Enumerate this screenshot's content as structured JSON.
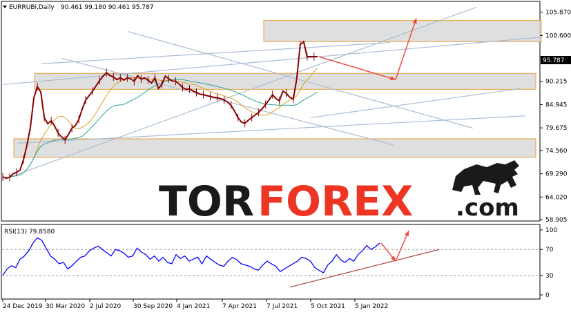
{
  "header": {
    "symbol": "EURRUBi,Daily",
    "ohlc": "90.461 99.180 90.461 95.787"
  },
  "rsi_header": {
    "label": "RSI(13) 79.8580"
  },
  "watermark": {
    "part1": "TOR",
    "part2": "FOREX",
    "part3": ".com",
    "colors": {
      "dark": "#1a1a1a",
      "red": "#ee3524"
    }
  },
  "colors": {
    "candles": "#8b0000",
    "ma_fast": "#d9a020",
    "ma_slow": "#2aa198",
    "rsi_line": "#0000ff",
    "trendline": "#a9bdd6",
    "zone_border": "#e6a23c",
    "arrow": "#f0453a",
    "rsi_trend": "#b04040",
    "current_price_tag": "#000000"
  },
  "chart_data": [
    {
      "type": "line",
      "name": "price",
      "ylim": [
        58.905,
        108.0
      ],
      "y_ticks": [
        "105.870",
        "100.600",
        "95.787",
        "90.215",
        "84.945",
        "79.675",
        "74.560",
        "69.290",
        "64.020",
        "58.905"
      ],
      "x_ticks": [
        "24 Dec 2019",
        "30 Mar 2020",
        "2 Jul 2020",
        "30 Sep 2020",
        "4 Jan 2021",
        "7 Apr 2021",
        "7 Jul 2021",
        "5 Oct 2021",
        "5 Jan 2022"
      ],
      "current_price": "95.787",
      "x_index": [
        0,
        5,
        10,
        15,
        20,
        25,
        30,
        35,
        40,
        45,
        50,
        55,
        60,
        65,
        70,
        75,
        80,
        85,
        90,
        95,
        100,
        105,
        110,
        115,
        120,
        125,
        130,
        135,
        140,
        145,
        150,
        155,
        160,
        165,
        170,
        175,
        180,
        185,
        190,
        195,
        200,
        205,
        210,
        215,
        220,
        225,
        230,
        235,
        240,
        245,
        250,
        255,
        260,
        265,
        270,
        275,
        280,
        285,
        290,
        295,
        300,
        305,
        310,
        315,
        320,
        325,
        330,
        335,
        340,
        345,
        350,
        355,
        360,
        365,
        370,
        375,
        380,
        385,
        390,
        395,
        400,
        405,
        410,
        415,
        420,
        425,
        430,
        435,
        440,
        445,
        450,
        455,
        460,
        465,
        470,
        475,
        480,
        485,
        490,
        495,
        500,
        505,
        510,
        515,
        520,
        525,
        530,
        535,
        540,
        545,
        550,
        555
      ],
      "values": [
        68.6,
        68.3,
        68.5,
        69.3,
        69.6,
        70.1,
        72.5,
        75.8,
        79.9,
        86.5,
        89.0,
        87.8,
        82.0,
        80.6,
        81.3,
        80.1,
        78.5,
        77.6,
        77.0,
        78.2,
        79.6,
        80.2,
        81.6,
        84.0,
        86.0,
        87.0,
        88.0,
        89.2,
        90.4,
        91.4,
        92.2,
        91.5,
        91.2,
        90.6,
        91.0,
        90.5,
        91.0,
        90.8,
        90.2,
        91.5,
        90.7,
        91.0,
        90.5,
        89.8,
        91.0,
        88.6,
        89.5,
        91.4,
        90.8,
        90.3,
        90.2,
        89.6,
        88.8,
        88.4,
        88.5,
        88.0,
        87.7,
        87.3,
        87.2,
        87.0,
        86.8,
        86.6,
        86.5,
        86.3,
        86.0,
        85.5,
        84.8,
        83.5,
        82.0,
        81.0,
        80.7,
        81.4,
        82.0,
        82.6,
        83.2,
        84.0,
        85.0,
        86.0,
        87.2,
        86.3,
        85.8,
        88.0,
        87.5,
        86.6,
        86.2,
        90.8,
        98.5,
        99.2,
        95.8,
        95.8,
        95.8,
        95.8,
        95.8,
        95.8,
        95.8,
        95.8,
        95.8,
        95.8,
        95.8,
        95.8,
        95.8,
        95.8,
        95.8,
        95.8,
        95.8,
        95.8,
        95.8,
        95.8,
        95.8,
        95.8,
        95.8,
        95.8
      ]
    },
    {
      "type": "line",
      "name": "RSI(13)",
      "ylim": [
        0,
        100
      ],
      "y_ticks": [
        "100",
        "70",
        "30",
        "0"
      ],
      "last_value": 79.858,
      "values": [
        30,
        40,
        45,
        42,
        55,
        60,
        68,
        80,
        88,
        84,
        72,
        60,
        55,
        48,
        50,
        40,
        45,
        52,
        58,
        60,
        68,
        72,
        75,
        70,
        65,
        60,
        70,
        68,
        64,
        58,
        60,
        72,
        66,
        62,
        55,
        60,
        52,
        58,
        50,
        48,
        62,
        56,
        60,
        52,
        55,
        58,
        48,
        60,
        55,
        50,
        46,
        44,
        52,
        58,
        54,
        48,
        46,
        44,
        40,
        38,
        46,
        52,
        48,
        44,
        36,
        40,
        44,
        48,
        52,
        58,
        56,
        52,
        42,
        38,
        34,
        46,
        52,
        62,
        54,
        50,
        56,
        52,
        62,
        68,
        76,
        70,
        74,
        79.86
      ]
    }
  ]
}
